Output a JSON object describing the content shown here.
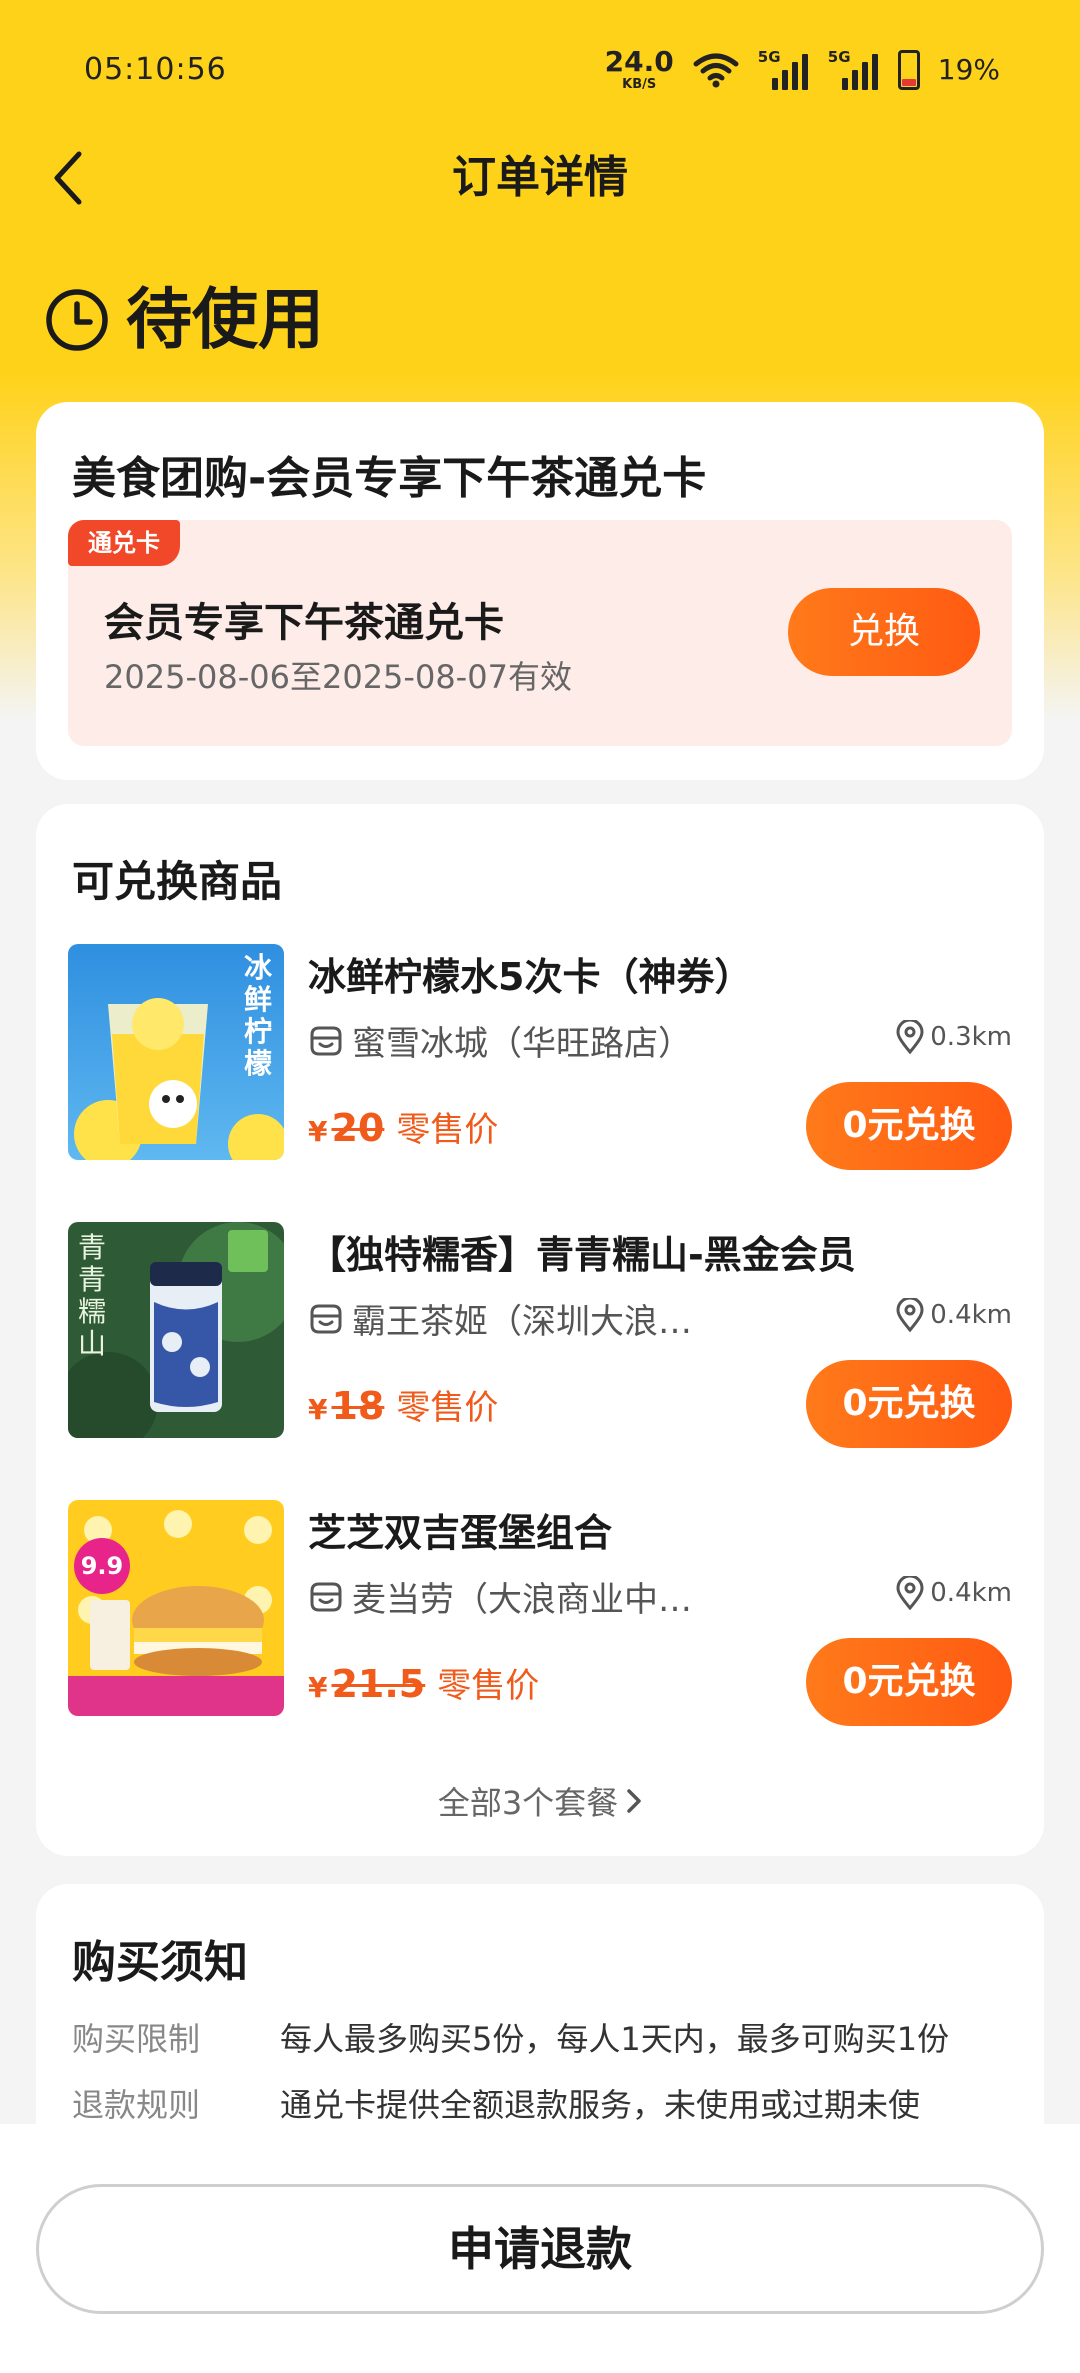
{
  "status_bar": {
    "time": "05:10:56",
    "net_speed": "24.0",
    "net_unit": "KB/S",
    "signal1_tag": "5G",
    "signal2_tag": "5G",
    "battery_pct": "19%",
    "battery_level": 0.19
  },
  "header": {
    "title": "订单详情"
  },
  "order_status": "待使用",
  "card": {
    "title": "美食团购-会员专享下午茶通兑卡",
    "badge": "通兑卡",
    "voucher_name": "会员专享下午茶通兑卡",
    "validity": "2025-08-06至2025-08-07有效",
    "exchange_label": "兑换"
  },
  "products_section": {
    "title": "可兑换商品",
    "items": [
      {
        "name": "冰鲜柠檬水5次卡（神券）",
        "shop": "蜜雪冰城（华旺路店）",
        "distance": "0.3km",
        "yen": "¥",
        "price": "20",
        "price_label": "零售价",
        "button": "0元兑换"
      },
      {
        "name": "【独特糯香】青青糯山-黑金会员",
        "shop": "霸王茶姬（深圳大浪…",
        "distance": "0.4km",
        "yen": "¥",
        "price": "18",
        "price_label": "零售价",
        "button": "0元兑换"
      },
      {
        "name": "芝芝双吉蛋堡组合",
        "shop": "麦当劳（大浪商业中…",
        "distance": "0.4km",
        "yen": "¥",
        "price": "21.5",
        "price_label": "零售价",
        "button": "0元兑换"
      }
    ],
    "thumb_texts": {
      "lemon": "冰鲜柠檬",
      "tea": "青青糯山",
      "burger_badge": "9.9"
    },
    "see_all": "全部3个套餐"
  },
  "notice": {
    "title": "购买须知",
    "rows": [
      {
        "key": "购买限制",
        "value": "每人最多购买5份，每人1天内，最多可购买1份"
      },
      {
        "key": "退款规则",
        "value": "通兑卡提供全额退款服务，未使用或过期未使"
      }
    ]
  },
  "bottom": {
    "refund_label": "申请退款"
  },
  "colors": {
    "brand_yellow": "#ffd21a",
    "accent_orange": "#ff5a12",
    "price_orange": "#f05a1a",
    "badge_red": "#f2482a",
    "voucher_bg": "#fdece8"
  }
}
